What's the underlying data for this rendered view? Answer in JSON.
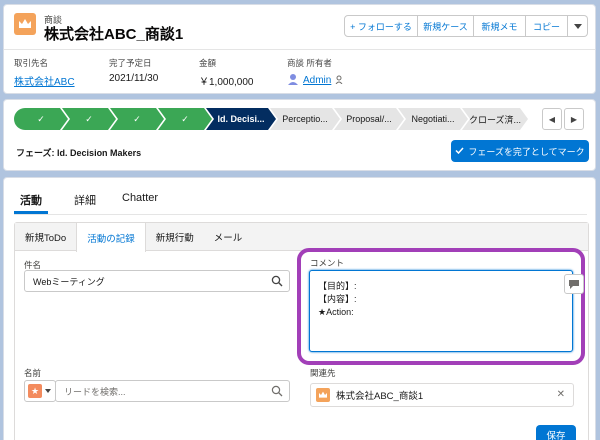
{
  "header": {
    "object_type": "商談",
    "record_name": "株式会社ABC_商談1",
    "buttons": {
      "follow": "+ フォローする",
      "new_case": "新規ケース",
      "new_memo": "新規メモ",
      "copy": "コピー"
    },
    "fields": [
      {
        "label": "取引先名",
        "value": "株式会社ABC"
      },
      {
        "label": "完了予定日",
        "value": "2021/11/30"
      },
      {
        "label": "金額",
        "value": "￥1,000,000"
      },
      {
        "label": "商談 所有者",
        "value": "Admin"
      }
    ]
  },
  "path": {
    "stages": [
      {
        "label": "✓",
        "status": "done"
      },
      {
        "label": "✓",
        "status": "done"
      },
      {
        "label": "✓",
        "status": "done"
      },
      {
        "label": "✓",
        "status": "done"
      },
      {
        "label": "Id. Decisi...",
        "status": "current"
      },
      {
        "label": "Perceptio...",
        "status": "todo"
      },
      {
        "label": "Proposal/...",
        "status": "todo"
      },
      {
        "label": "Negotiati...",
        "status": "todo"
      },
      {
        "label": "クローズ済...",
        "status": "todo"
      }
    ],
    "phase_text": "フェーズ: Id. Decision Makers",
    "complete_button": "フェーズを完了としてマーク"
  },
  "activity": {
    "main_tabs": [
      "活動",
      "詳細",
      "Chatter"
    ],
    "sub_tabs": [
      "新規ToDo",
      "活動の記録",
      "新規行動",
      "メール"
    ],
    "subject_label": "件名",
    "subject_value": "Webミーティング",
    "comment_label": "コメント",
    "comment_lines": [
      "【目的】:",
      "【内容】:",
      "★Action:"
    ],
    "name_label": "名前",
    "name_placeholder": "リードを検索...",
    "related_label": "関連先",
    "related_value": "株式会社ABC_商談1",
    "save_button": "保存"
  },
  "colors": {
    "brand_blue": "#0176d3",
    "path_done": "#3ba755",
    "path_current": "#032d60",
    "highlight": "#a23fb8",
    "opportunity_icon": "#f4a35b",
    "lead_icon": "#f38b5e"
  },
  "icons": [
    "crown-icon",
    "check-icon",
    "search-icon",
    "chat-bubble-icon",
    "star-icon",
    "chevron-down-icon",
    "close-icon",
    "avatar-icon",
    "chevron-left-icon",
    "chevron-right-icon"
  ]
}
